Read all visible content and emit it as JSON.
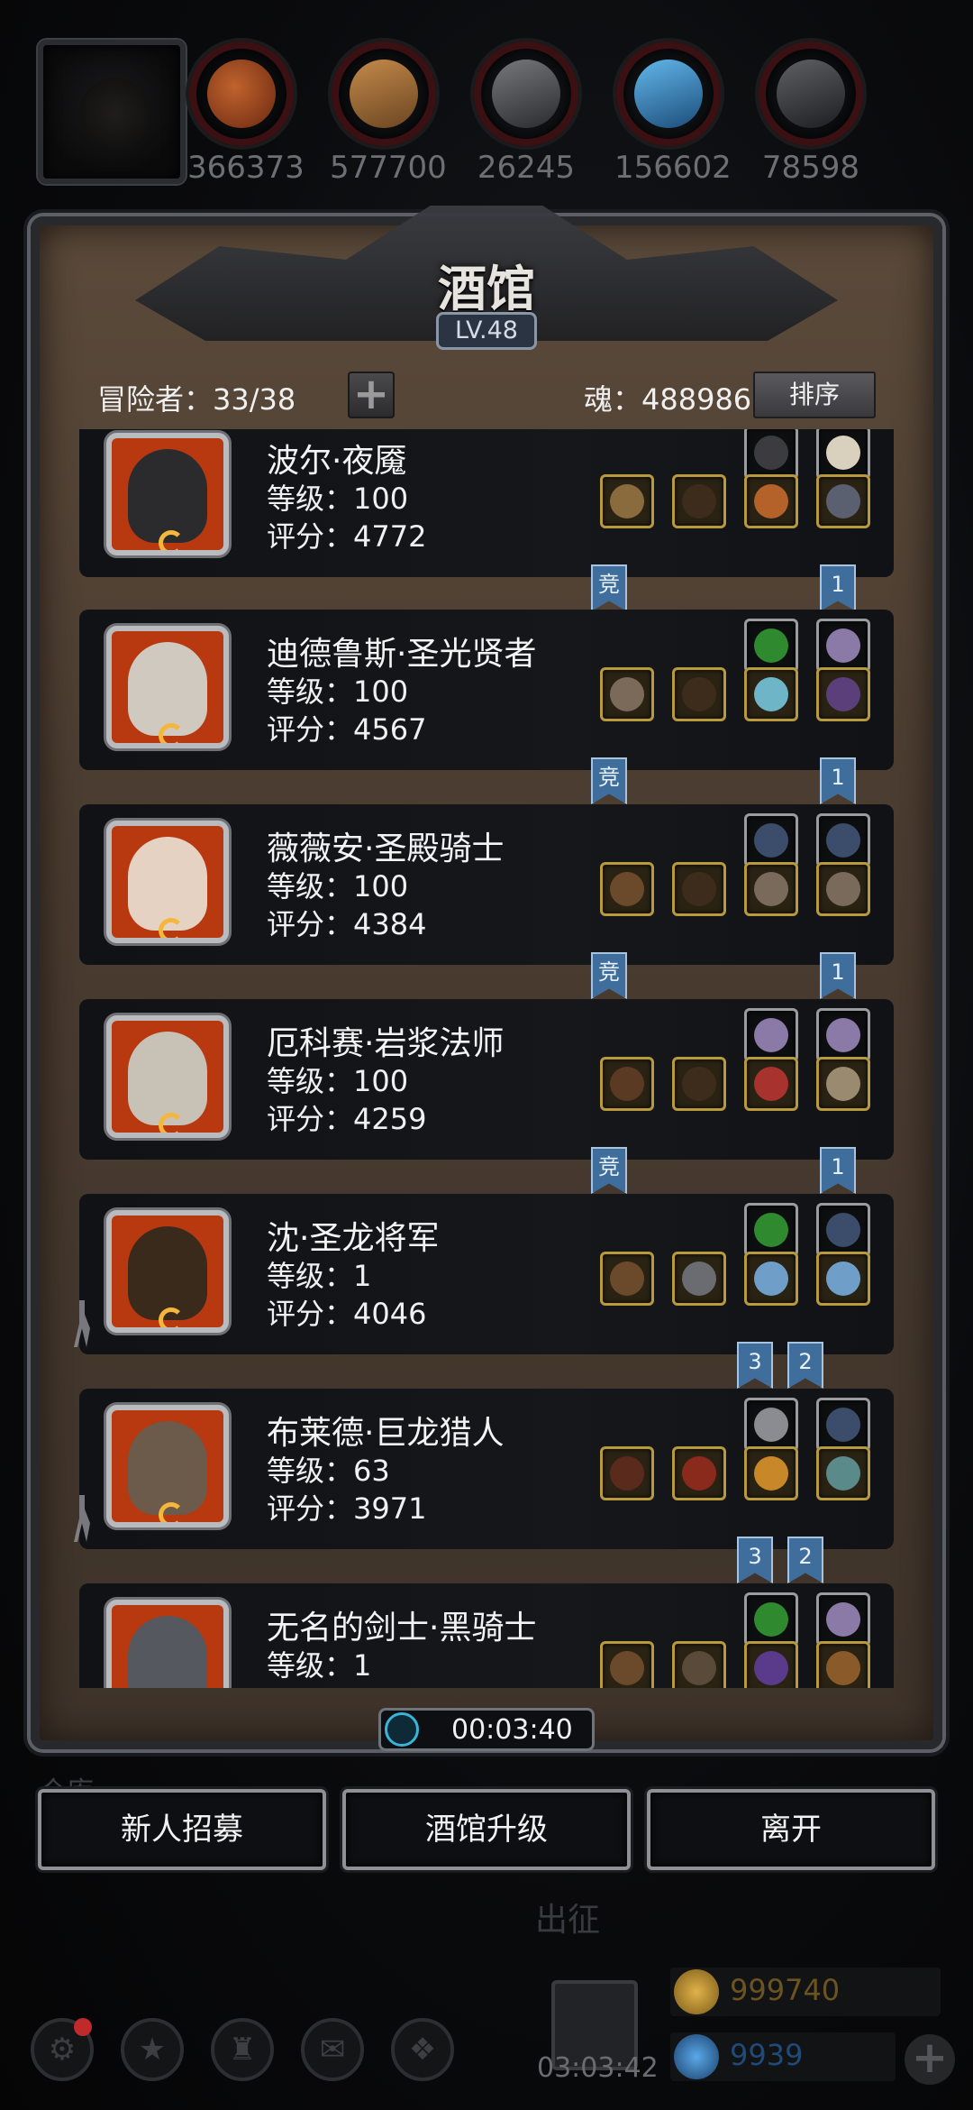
{
  "resources": [
    {
      "icon": "meat-icon",
      "value": "366373",
      "color": "#8a3a1c"
    },
    {
      "icon": "wood-icon",
      "value": "577700",
      "color": "#7a5430"
    },
    {
      "icon": "iron-ingot-icon",
      "value": "26245",
      "color": "#4a4b4f"
    },
    {
      "icon": "crystal-icon",
      "value": "156602",
      "color": "#2e6aa0"
    },
    {
      "icon": "ore-icon",
      "value": "78598",
      "color": "#3a3b3e"
    }
  ],
  "tavern": {
    "title": "酒馆",
    "level": "LV.48",
    "adventurers_label": "冒险者：33/38",
    "add_symbol": "+",
    "soul_label": "魂：488986",
    "sort_label": "排序"
  },
  "heroes": [
    {
      "name": "波尔·夜魇",
      "level": "等级：100",
      "score": "评分：4772",
      "tint": "#2b2b2e",
      "ribbons": [
        "竞",
        "1"
      ],
      "walker": false
    },
    {
      "name": "迪德鲁斯·圣光贤者",
      "level": "等级：100",
      "score": "评分：4567",
      "tint": "#cfc9bf",
      "ribbons": [
        "竞",
        "1"
      ],
      "walker": false
    },
    {
      "name": "薇薇安·圣殿骑士",
      "level": "等级：100",
      "score": "评分：4384",
      "tint": "#e6d2c2",
      "ribbons": [
        "竞",
        "1"
      ],
      "walker": false
    },
    {
      "name": "厄科赛·岩浆法师",
      "level": "等级：100",
      "score": "评分：4259",
      "tint": "#c7c1b6",
      "ribbons": [
        "竞",
        "1"
      ],
      "walker": false
    },
    {
      "name": "沈·圣龙将军",
      "level": "等级：1",
      "score": "评分：4046",
      "tint": "#3a2a1c",
      "ribbons": [
        "3",
        "2"
      ],
      "walker": true
    },
    {
      "name": "布莱德·巨龙猎人",
      "level": "等级：63",
      "score": "评分：3971",
      "tint": "#6c5a4b",
      "ribbons": [
        "3",
        "2"
      ],
      "walker": true
    },
    {
      "name": "无名的剑士·黑骑士",
      "level": "等级：1",
      "score": "",
      "tint": "#55585e",
      "ribbons": [],
      "walker": false
    }
  ],
  "timer": "00:03:40",
  "buttons": {
    "recruit": "新人招募",
    "upgrade": "酒馆升级",
    "leave": "离开"
  },
  "background_text": {
    "warehouse": "仓库",
    "sortie": "出征",
    "gift_timer": "03:03:42"
  },
  "currency": {
    "gold": "999740",
    "gems": "9939",
    "gold_color": "#b8892a",
    "gem_color": "#2a6fb5"
  },
  "nav": [
    "settings-icon",
    "achievement-icon",
    "tower-icon",
    "mail-icon",
    "cube-icon"
  ]
}
